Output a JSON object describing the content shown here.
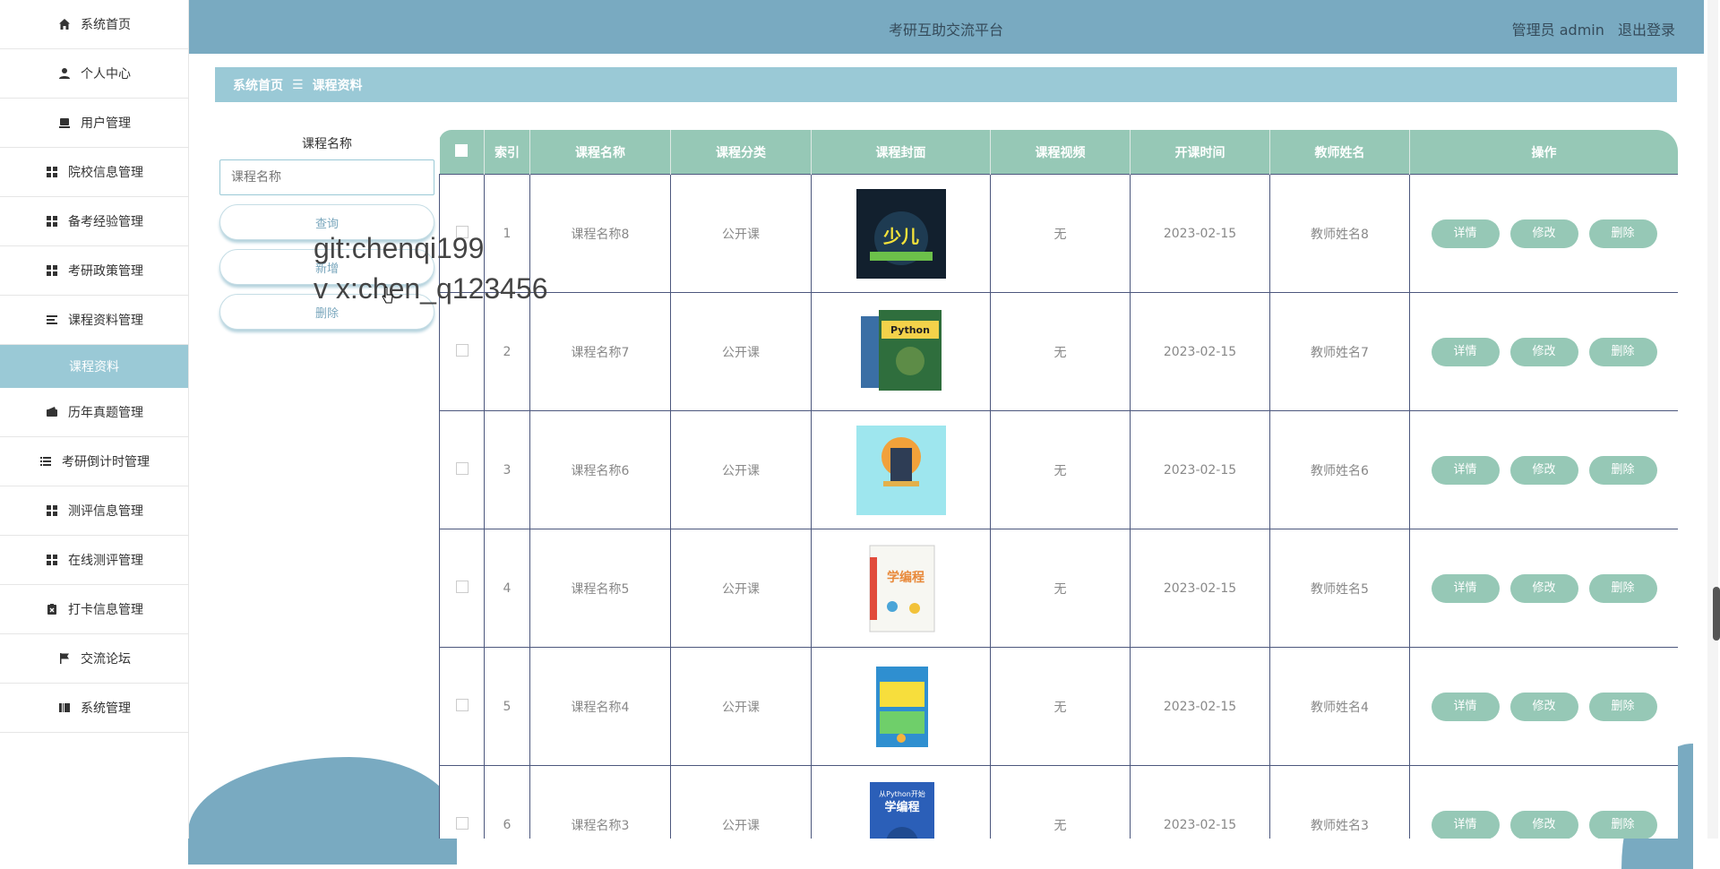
{
  "app": {
    "title": "考研互助交流平台"
  },
  "header": {
    "user_text": "管理员 admin",
    "logout": "退出登录"
  },
  "sidebar": {
    "items": [
      {
        "label": "系统首页",
        "icon": "home-icon"
      },
      {
        "label": "个人中心",
        "icon": "user-icon"
      },
      {
        "label": "用户管理",
        "icon": "monitor-icon"
      },
      {
        "label": "院校信息管理",
        "icon": "grid-icon"
      },
      {
        "label": "备考经验管理",
        "icon": "grid-icon"
      },
      {
        "label": "考研政策管理",
        "icon": "grid-icon"
      },
      {
        "label": "课程资料管理",
        "icon": "list-icon"
      },
      {
        "label": "课程资料",
        "icon": "",
        "sub": true
      },
      {
        "label": "历年真题管理",
        "icon": "wallet-icon"
      },
      {
        "label": "考研倒计时管理",
        "icon": "list-icon"
      },
      {
        "label": "测评信息管理",
        "icon": "grid-icon"
      },
      {
        "label": "在线测评管理",
        "icon": "grid-icon"
      },
      {
        "label": "打卡信息管理",
        "icon": "clipboard-icon"
      },
      {
        "label": "交流论坛",
        "icon": "flag-icon"
      },
      {
        "label": "系统管理",
        "icon": "book-icon"
      }
    ]
  },
  "breadcrumb": {
    "home": "系统首页",
    "sep": "☰",
    "current": "课程资料"
  },
  "search": {
    "label": "课程名称",
    "placeholder": "课程名称",
    "query_btn": "查询",
    "add_btn": "新增",
    "delete_btn": "删除"
  },
  "watermark": {
    "line1": "git:chenqi199",
    "line2": "v x:chen_q123456"
  },
  "table": {
    "headers": [
      "索引",
      "课程名称",
      "课程分类",
      "课程封面",
      "课程视频",
      "开课时间",
      "教师姓名",
      "操作"
    ],
    "actions": {
      "detail": "详情",
      "edit": "修改",
      "delete": "删除"
    },
    "rows": [
      {
        "index": "1",
        "name": "课程名称8",
        "category": "公开课",
        "video": "无",
        "date": "2023-02-15",
        "teacher": "教师姓名8",
        "cover": "cover-1"
      },
      {
        "index": "2",
        "name": "课程名称7",
        "category": "公开课",
        "video": "无",
        "date": "2023-02-15",
        "teacher": "教师姓名7",
        "cover": "cover-2"
      },
      {
        "index": "3",
        "name": "课程名称6",
        "category": "公开课",
        "video": "无",
        "date": "2023-02-15",
        "teacher": "教师姓名6",
        "cover": "cover-3"
      },
      {
        "index": "4",
        "name": "课程名称5",
        "category": "公开课",
        "video": "无",
        "date": "2023-02-15",
        "teacher": "教师姓名5",
        "cover": "cover-4"
      },
      {
        "index": "5",
        "name": "课程名称4",
        "category": "公开课",
        "video": "无",
        "date": "2023-02-15",
        "teacher": "教师姓名4",
        "cover": "cover-5"
      },
      {
        "index": "6",
        "name": "课程名称3",
        "category": "公开课",
        "video": "无",
        "date": "2023-02-15",
        "teacher": "教师姓名3",
        "cover": "cover-6"
      }
    ]
  },
  "colors": {
    "topbar": "#79aac1",
    "header": "#96c8b6",
    "accent": "#9ac9d6"
  }
}
